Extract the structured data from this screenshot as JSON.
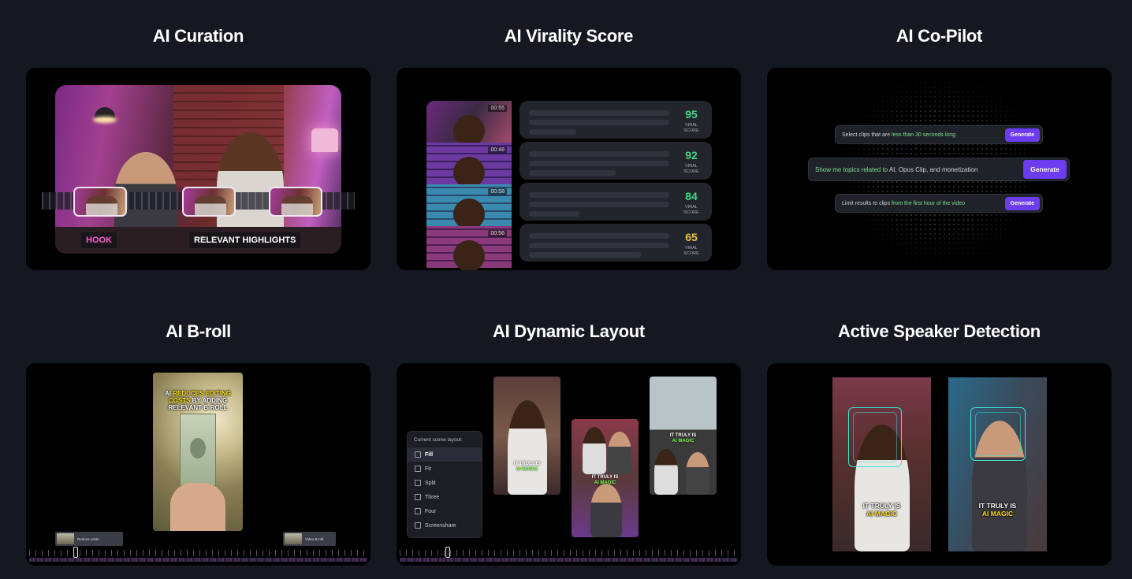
{
  "cells": {
    "curation": {
      "title": "AI Curation",
      "labels": {
        "hook": "HOOK",
        "highlights": "RELEVANT HIGHLIGHTS"
      }
    },
    "virality": {
      "title": "AI Virality Score",
      "clips": [
        {
          "timestamp": "00:55",
          "score": "95",
          "color": "#3ddc84"
        },
        {
          "timestamp": "00:48",
          "score": "92",
          "color": "#3ddc84"
        },
        {
          "timestamp": "00:58",
          "score": "84",
          "color": "#3ddc84"
        },
        {
          "timestamp": "00:56",
          "score": "65",
          "color": "#f4c23a"
        }
      ],
      "score_sub_1": "VIRAL",
      "score_sub_2": "SCORE"
    },
    "copilot": {
      "title": "AI Co-Pilot",
      "prompts": [
        {
          "plain": "Select clips that are ",
          "highlight": "less than 30 seconds long",
          "after": "",
          "button": "Generate"
        },
        {
          "plain": "",
          "highlight": "Show me topics related to ",
          "after": "AI, Opus Clip, and monetization",
          "button": "Generate"
        },
        {
          "plain": "Limit results to clips ",
          "highlight": "from the first hour of the video",
          "after": "",
          "button": "Generate"
        }
      ]
    },
    "broll": {
      "title": "AI B-roll",
      "caption": {
        "w1": "AI ",
        "w2": "REDUCES EDITING",
        "w3": "COSTS",
        "w4": " BY ADDING",
        "w5": "RELEVANT B-ROLL"
      },
      "clip_left": "Reduce costs",
      "clip_right": "Video B-roll"
    },
    "dynamic": {
      "title": "AI Dynamic Layout",
      "panel_title": "Current scene layout:",
      "options": [
        "Fill",
        "Fit",
        "Split",
        "Three",
        "Four",
        "Screenshare"
      ],
      "selected": "Fill",
      "caption_top": "IT TRULY IS",
      "caption_bottom": "AI MAGIC"
    },
    "speaker": {
      "title": "Active Speaker Detection",
      "caption_top": "IT TRULY IS",
      "caption_bottom": "AI MAGIC"
    }
  }
}
